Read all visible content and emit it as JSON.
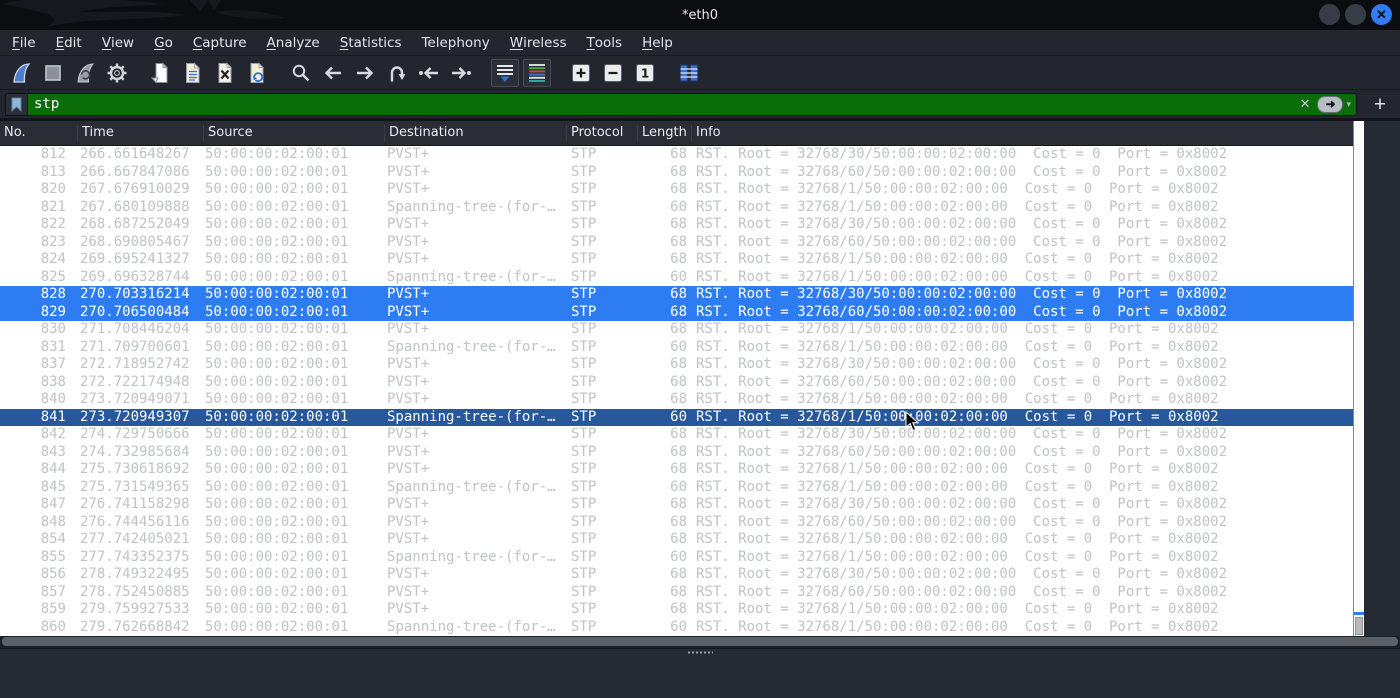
{
  "window": {
    "title": "*eth0",
    "controls": {
      "minimize": "",
      "maximize": "",
      "close_glyph": "✕"
    }
  },
  "menu_bar": {
    "items": [
      {
        "label": "File",
        "mnemonic": 0
      },
      {
        "label": "Edit",
        "mnemonic": 0
      },
      {
        "label": "View",
        "mnemonic": 0
      },
      {
        "label": "Go",
        "mnemonic": 0
      },
      {
        "label": "Capture",
        "mnemonic": 0
      },
      {
        "label": "Analyze",
        "mnemonic": 0
      },
      {
        "label": "Statistics",
        "mnemonic": 0
      },
      {
        "label": "Telephony",
        "mnemonic": -1
      },
      {
        "label": "Wireless",
        "mnemonic": 0
      },
      {
        "label": "Tools",
        "mnemonic": 0
      },
      {
        "label": "Help",
        "mnemonic": 0
      }
    ]
  },
  "toolbar": {
    "buttons": [
      {
        "name": "start-capture",
        "icon": "wireshark-fin",
        "group_start": false
      },
      {
        "name": "stop-capture",
        "icon": "stop-square",
        "group_start": false
      },
      {
        "name": "restart-capture",
        "icon": "wireshark-fin-restart",
        "group_start": false
      },
      {
        "name": "capture-options",
        "icon": "gear",
        "group_start": false
      },
      {
        "name": "open-file",
        "icon": "document-open",
        "group_start": true
      },
      {
        "name": "save-file",
        "icon": "document-save",
        "group_start": false
      },
      {
        "name": "close-file",
        "icon": "document-close",
        "group_start": false
      },
      {
        "name": "reload-file",
        "icon": "document-reload",
        "group_start": false
      },
      {
        "name": "find-packet",
        "icon": "magnifier",
        "group_start": true
      },
      {
        "name": "go-back",
        "icon": "arrow-left",
        "group_start": false
      },
      {
        "name": "go-forward",
        "icon": "arrow-right",
        "group_start": false
      },
      {
        "name": "go-to-packet",
        "icon": "arrow-hook",
        "group_start": false
      },
      {
        "name": "first-packet",
        "icon": "arrow-to-start",
        "group_start": false
      },
      {
        "name": "last-packet",
        "icon": "arrow-to-end",
        "group_start": false
      },
      {
        "name": "auto-scroll",
        "icon": "list-down-arrow",
        "group_start": true,
        "boxed": true
      },
      {
        "name": "colorize",
        "icon": "colored-list",
        "group_start": false,
        "boxed": true
      },
      {
        "name": "zoom-in",
        "icon": "plus-box",
        "group_start": true
      },
      {
        "name": "zoom-out",
        "icon": "minus-box",
        "group_start": false
      },
      {
        "name": "normal-size",
        "icon": "one-box",
        "glyph": "1",
        "group_start": false
      },
      {
        "name": "resize-columns",
        "icon": "columns",
        "group_start": true
      }
    ]
  },
  "filter_bar": {
    "value": "stp",
    "clear_glyph": "✕",
    "apply_glyph": "➜",
    "dropdown_glyph": "▾",
    "add_label": "+"
  },
  "packet_table": {
    "columns": [
      {
        "label": "No.",
        "slug": "no"
      },
      {
        "label": "Time",
        "slug": "time"
      },
      {
        "label": "Source",
        "slug": "source"
      },
      {
        "label": "Destination",
        "slug": "destination"
      },
      {
        "label": "Protocol",
        "slug": "protocol"
      },
      {
        "label": "Length",
        "slug": "length"
      },
      {
        "label": "Info",
        "slug": "info"
      }
    ],
    "rows": [
      {
        "no": "812",
        "time": "266.661648267",
        "source": "50:00:00:02:00:01",
        "destination": "PVST+",
        "protocol": "STP",
        "length": "68",
        "info": "RST. Root = 32768/30/50:00:00:02:00:00  Cost = 0  Port = 0x8002",
        "state": "normal"
      },
      {
        "no": "813",
        "time": "266.667847086",
        "source": "50:00:00:02:00:01",
        "destination": "PVST+",
        "protocol": "STP",
        "length": "68",
        "info": "RST. Root = 32768/60/50:00:00:02:00:00  Cost = 0  Port = 0x8002",
        "state": "normal"
      },
      {
        "no": "820",
        "time": "267.676910029",
        "source": "50:00:00:02:00:01",
        "destination": "PVST+",
        "protocol": "STP",
        "length": "68",
        "info": "RST. Root = 32768/1/50:00:00:02:00:00  Cost = 0  Port = 0x8002",
        "state": "normal"
      },
      {
        "no": "821",
        "time": "267.680109888",
        "source": "50:00:00:02:00:01",
        "destination": "Spanning-tree-(for-…",
        "protocol": "STP",
        "length": "60",
        "info": "RST. Root = 32768/1/50:00:00:02:00:00  Cost = 0  Port = 0x8002",
        "state": "normal"
      },
      {
        "no": "822",
        "time": "268.687252049",
        "source": "50:00:00:02:00:01",
        "destination": "PVST+",
        "protocol": "STP",
        "length": "68",
        "info": "RST. Root = 32768/30/50:00:00:02:00:00  Cost = 0  Port = 0x8002",
        "state": "normal"
      },
      {
        "no": "823",
        "time": "268.690805467",
        "source": "50:00:00:02:00:01",
        "destination": "PVST+",
        "protocol": "STP",
        "length": "68",
        "info": "RST. Root = 32768/60/50:00:00:02:00:00  Cost = 0  Port = 0x8002",
        "state": "normal"
      },
      {
        "no": "824",
        "time": "269.695241327",
        "source": "50:00:00:02:00:01",
        "destination": "PVST+",
        "protocol": "STP",
        "length": "68",
        "info": "RST. Root = 32768/1/50:00:00:02:00:00  Cost = 0  Port = 0x8002",
        "state": "normal"
      },
      {
        "no": "825",
        "time": "269.696328744",
        "source": "50:00:00:02:00:01",
        "destination": "Spanning-tree-(for-…",
        "protocol": "STP",
        "length": "60",
        "info": "RST. Root = 32768/1/50:00:00:02:00:00  Cost = 0  Port = 0x8002",
        "state": "normal"
      },
      {
        "no": "828",
        "time": "270.703316214",
        "source": "50:00:00:02:00:01",
        "destination": "PVST+",
        "protocol": "STP",
        "length": "68",
        "info": "RST. Root = 32768/30/50:00:00:02:00:00  Cost = 0  Port = 0x8002",
        "state": "selected"
      },
      {
        "no": "829",
        "time": "270.706500484",
        "source": "50:00:00:02:00:01",
        "destination": "PVST+",
        "protocol": "STP",
        "length": "68",
        "info": "RST. Root = 32768/60/50:00:00:02:00:00  Cost = 0  Port = 0x8002",
        "state": "selected"
      },
      {
        "no": "830",
        "time": "271.708446204",
        "source": "50:00:00:02:00:01",
        "destination": "PVST+",
        "protocol": "STP",
        "length": "68",
        "info": "RST. Root = 32768/1/50:00:00:02:00:00  Cost = 0  Port = 0x8002",
        "state": "normal"
      },
      {
        "no": "831",
        "time": "271.709700601",
        "source": "50:00:00:02:00:01",
        "destination": "Spanning-tree-(for-…",
        "protocol": "STP",
        "length": "60",
        "info": "RST. Root = 32768/1/50:00:00:02:00:00  Cost = 0  Port = 0x8002",
        "state": "normal"
      },
      {
        "no": "837",
        "time": "272.718952742",
        "source": "50:00:00:02:00:01",
        "destination": "PVST+",
        "protocol": "STP",
        "length": "68",
        "info": "RST. Root = 32768/30/50:00:00:02:00:00  Cost = 0  Port = 0x8002",
        "state": "normal"
      },
      {
        "no": "838",
        "time": "272.722174948",
        "source": "50:00:00:02:00:01",
        "destination": "PVST+",
        "protocol": "STP",
        "length": "68",
        "info": "RST. Root = 32768/60/50:00:00:02:00:00  Cost = 0  Port = 0x8002",
        "state": "normal"
      },
      {
        "no": "840",
        "time": "273.720949071",
        "source": "50:00:00:02:00:01",
        "destination": "PVST+",
        "protocol": "STP",
        "length": "68",
        "info": "RST. Root = 32768/1/50:00:00:02:00:00  Cost = 0  Port = 0x8002",
        "state": "normal"
      },
      {
        "no": "841",
        "time": "273.720949307",
        "source": "50:00:00:02:00:01",
        "destination": "Spanning-tree-(for-…",
        "protocol": "STP",
        "length": "60",
        "info": "RST. Root = 32768/1/50:00:00:02:00:00  Cost = 0  Port = 0x8002",
        "state": "focused"
      },
      {
        "no": "842",
        "time": "274.729750666",
        "source": "50:00:00:02:00:01",
        "destination": "PVST+",
        "protocol": "STP",
        "length": "68",
        "info": "RST. Root = 32768/30/50:00:00:02:00:00  Cost = 0  Port = 0x8002",
        "state": "normal"
      },
      {
        "no": "843",
        "time": "274.732985684",
        "source": "50:00:00:02:00:01",
        "destination": "PVST+",
        "protocol": "STP",
        "length": "68",
        "info": "RST. Root = 32768/60/50:00:00:02:00:00  Cost = 0  Port = 0x8002",
        "state": "normal"
      },
      {
        "no": "844",
        "time": "275.730618692",
        "source": "50:00:00:02:00:01",
        "destination": "PVST+",
        "protocol": "STP",
        "length": "68",
        "info": "RST. Root = 32768/1/50:00:00:02:00:00  Cost = 0  Port = 0x8002",
        "state": "normal"
      },
      {
        "no": "845",
        "time": "275.731549365",
        "source": "50:00:00:02:00:01",
        "destination": "Spanning-tree-(for-…",
        "protocol": "STP",
        "length": "60",
        "info": "RST. Root = 32768/1/50:00:00:02:00:00  Cost = 0  Port = 0x8002",
        "state": "normal"
      },
      {
        "no": "847",
        "time": "276.741158298",
        "source": "50:00:00:02:00:01",
        "destination": "PVST+",
        "protocol": "STP",
        "length": "68",
        "info": "RST. Root = 32768/30/50:00:00:02:00:00  Cost = 0  Port = 0x8002",
        "state": "normal"
      },
      {
        "no": "848",
        "time": "276.744456116",
        "source": "50:00:00:02:00:01",
        "destination": "PVST+",
        "protocol": "STP",
        "length": "68",
        "info": "RST. Root = 32768/60/50:00:00:02:00:00  Cost = 0  Port = 0x8002",
        "state": "normal"
      },
      {
        "no": "854",
        "time": "277.742405021",
        "source": "50:00:00:02:00:01",
        "destination": "PVST+",
        "protocol": "STP",
        "length": "68",
        "info": "RST. Root = 32768/1/50:00:00:02:00:00  Cost = 0  Port = 0x8002",
        "state": "normal"
      },
      {
        "no": "855",
        "time": "277.743352375",
        "source": "50:00:00:02:00:01",
        "destination": "Spanning-tree-(for-…",
        "protocol": "STP",
        "length": "60",
        "info": "RST. Root = 32768/1/50:00:00:02:00:00  Cost = 0  Port = 0x8002",
        "state": "normal"
      },
      {
        "no": "856",
        "time": "278.749322495",
        "source": "50:00:00:02:00:01",
        "destination": "PVST+",
        "protocol": "STP",
        "length": "68",
        "info": "RST. Root = 32768/30/50:00:00:02:00:00  Cost = 0  Port = 0x8002",
        "state": "normal"
      },
      {
        "no": "857",
        "time": "278.752450885",
        "source": "50:00:00:02:00:01",
        "destination": "PVST+",
        "protocol": "STP",
        "length": "68",
        "info": "RST. Root = 32768/60/50:00:00:02:00:00  Cost = 0  Port = 0x8002",
        "state": "normal"
      },
      {
        "no": "859",
        "time": "279.759927533",
        "source": "50:00:00:02:00:01",
        "destination": "PVST+",
        "protocol": "STP",
        "length": "68",
        "info": "RST. Root = 32768/1/50:00:00:02:00:00  Cost = 0  Port = 0x8002",
        "state": "normal"
      },
      {
        "no": "860",
        "time": "279.762668842",
        "source": "50:00:00:02:00:01",
        "destination": "Spanning-tree-(for-…",
        "protocol": "STP",
        "length": "60",
        "info": "RST. Root = 32768/1/50:00:00:02:00:00  Cost = 0  Port = 0x8002",
        "state": "normal"
      }
    ]
  },
  "colors": {
    "selection_blue": "#2e7cf2",
    "focused_selection_blue": "#27589b",
    "filter_valid_green": "#0a6d0a",
    "row_text_gray": "#c1c3c4",
    "titlebar_bg": "#0b0d10",
    "chrome_bg": "#23262e",
    "close_button_blue": "#2f7cf6"
  }
}
